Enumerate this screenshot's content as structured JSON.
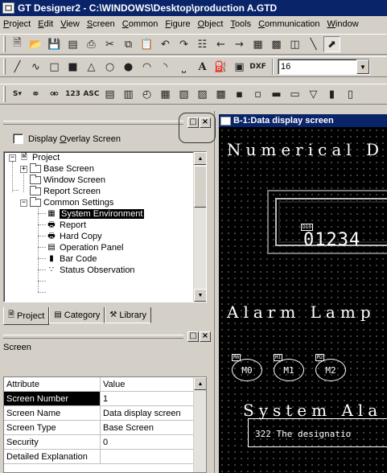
{
  "window": {
    "title": "GT Designer2 - C:\\WINDOWS\\Desktop\\production A.GTD"
  },
  "menu": {
    "items": [
      {
        "hotkey": "P",
        "rest": "roject"
      },
      {
        "hotkey": "E",
        "rest": "dit"
      },
      {
        "hotkey": "V",
        "rest": "iew"
      },
      {
        "hotkey": "S",
        "rest": "creen"
      },
      {
        "hotkey": "C",
        "rest": "ommon"
      },
      {
        "hotkey": "F",
        "rest": "igure"
      },
      {
        "hotkey": "O",
        "rest": "bject"
      },
      {
        "hotkey": "T",
        "rest": "ools"
      },
      {
        "hotkey": "C",
        "rest": "ommunication"
      },
      {
        "hotkey": "W",
        "rest": "indow"
      }
    ]
  },
  "toolbar": {
    "font_size_value": "16",
    "dxf_label": "DXF",
    "num_label": "123",
    "asc_label": "ASC"
  },
  "left_pane": {
    "overlay_checkbox": {
      "pre": "Display ",
      "hotkey": "O",
      "post": "verlay Screen",
      "checked": false
    },
    "tree": {
      "root": "Project",
      "base_screen": "Base Screen",
      "window_screen": "Window Screen",
      "report_screen": "Report Screen",
      "common_settings": "Common Settings",
      "system_environment": "System Environment",
      "report": "Report",
      "hard_copy": "Hard Copy",
      "operation_panel": "Operation Panel",
      "bar_code": "Bar Code",
      "status_observation": "Status Observation"
    },
    "tabs": [
      {
        "label": "Project",
        "active": true
      },
      {
        "label": "Category",
        "active": false
      },
      {
        "label": "Library",
        "active": false
      }
    ],
    "property_title": "Screen",
    "property_table": {
      "headers": [
        "Attribute",
        "Value"
      ],
      "rows": [
        [
          "Screen Number",
          "1"
        ],
        [
          "Screen Name",
          "Data display screen"
        ],
        [
          "Screen Type",
          "Base Screen"
        ],
        [
          "Security",
          "0"
        ],
        [
          "Detailed Explanation",
          ""
        ]
      ]
    }
  },
  "editor": {
    "title": "B-1:Data display screen",
    "heading_numerical": "Numerical D",
    "numeric_tag": "D10",
    "numeric_value": "01234",
    "heading_alarm": "Alarm Lamp",
    "lamps": [
      {
        "tag": "M0",
        "label": "M0"
      },
      {
        "tag": "M1",
        "label": "M1"
      },
      {
        "tag": "M2",
        "label": "M2"
      }
    ],
    "heading_system": "System Ala",
    "system_alarm_text": "322 The designatio"
  },
  "colors": {
    "title_bar": "#0a246a",
    "canvas": "#000000",
    "chrome": "#d4d0c8"
  }
}
